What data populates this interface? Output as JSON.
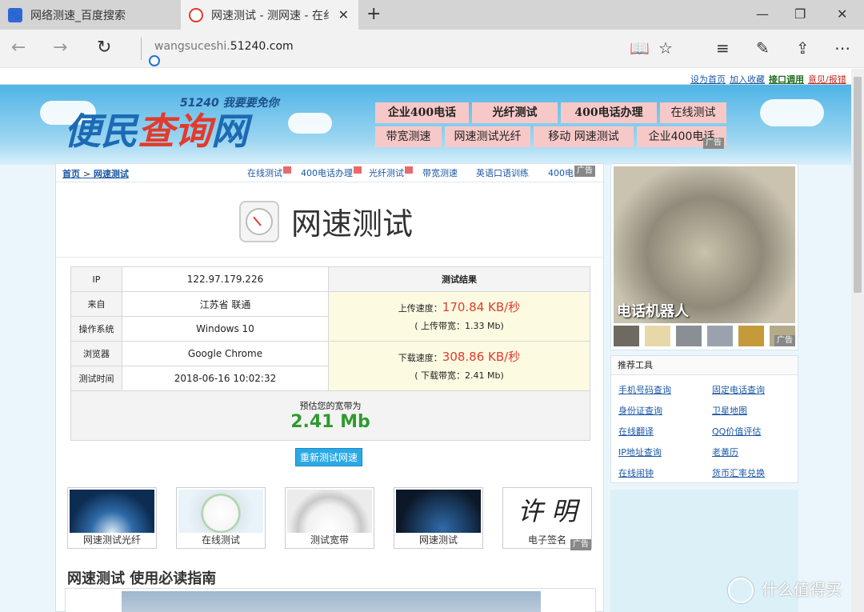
{
  "browser": {
    "tabs": [
      {
        "title": "网络测速_百度搜索",
        "icon": "baidu-paw-icon"
      },
      {
        "title": "网速测试 - 测网速 - 在纟",
        "icon": "51240-logo-icon"
      }
    ],
    "new_tab_symbol": "+",
    "close_symbol": "✕",
    "window_controls": {
      "minimize": "—",
      "maximize": "❐",
      "close": "✕"
    },
    "nav": {
      "back": "←",
      "forward": "→",
      "refresh": "↻"
    },
    "address": {
      "prefix": "wangsuceshi.",
      "domain": "51240.com"
    },
    "toolbar": {
      "reading": "📖",
      "favorite": "☆",
      "hub": "≡",
      "note": "✎",
      "share": "⇪",
      "more": "⋯"
    }
  },
  "site": {
    "top_links": [
      "设为首页",
      "加入收藏",
      "接口调用",
      "意见/报错"
    ],
    "logo": {
      "main_prefix": "便民",
      "main_red": "查询",
      "main_suffix": "网",
      "slogan": "51240 我要要免你"
    },
    "topnav_row1": [
      "企业400电话",
      "光纤测试",
      "400电话办理",
      "在线测试"
    ],
    "topnav_row2": [
      "带宽测速",
      "网速测试光纤",
      "移动 网速测试",
      "企业400电话"
    ],
    "ad_label": "广告"
  },
  "breadcrumb": {
    "home": "首页",
    "sep": ">",
    "current": "网速测试"
  },
  "sublinks": [
    "在线测试",
    "400电话办理",
    "光纤测试",
    "带宽测速",
    "英语口语训练",
    "400电"
  ],
  "page_title": "网速测试",
  "result": {
    "rows": [
      {
        "label": "IP",
        "value": "122.97.179.226"
      },
      {
        "label": "来自",
        "value": "江苏省 联通"
      },
      {
        "label": "操作系统",
        "value": "Windows 10"
      },
      {
        "label": "浏览器",
        "value": "Google Chrome"
      },
      {
        "label": "测试时间",
        "value": "2018-06-16 10:02:32"
      }
    ],
    "header": "测试结果",
    "upload_label": "上传速度：",
    "upload_speed": "170.84 KB/秒",
    "upload_bw": "( 上传带宽：1.33 Mb)",
    "download_label": "下载速度：",
    "download_speed": "308.86 KB/秒",
    "download_bw": "( 下载带宽：2.41 Mb)",
    "estimate_label": "预估您的宽带为",
    "estimate_value": "2.41 Mb"
  },
  "retest_button": "重新测试网速",
  "thumbs": [
    "网速测试光纤",
    "在线测试",
    "测试宽带",
    "网速测试",
    "电子签名"
  ],
  "signature_text": "许 明",
  "guide_title": "网速测试 使用必读指南",
  "ad": {
    "caption": "电话机器人"
  },
  "tools": {
    "header": "推荐工具",
    "items": [
      "手机号码查询",
      "固定电话查询",
      "身份证查询",
      "卫星地图",
      "在线翻译",
      "QQ价值评估",
      "IP地址查询",
      "老黄历",
      "在线闹钟",
      "货币汇率兑换"
    ]
  },
  "watermark": "什么值得买",
  "colors": {
    "accent_red": "#e23b2c",
    "link_blue": "#1b58a5",
    "good_green": "#2f9a2f",
    "button_blue": "#2aa9e6",
    "nav_pink": "#f7c8c8"
  }
}
